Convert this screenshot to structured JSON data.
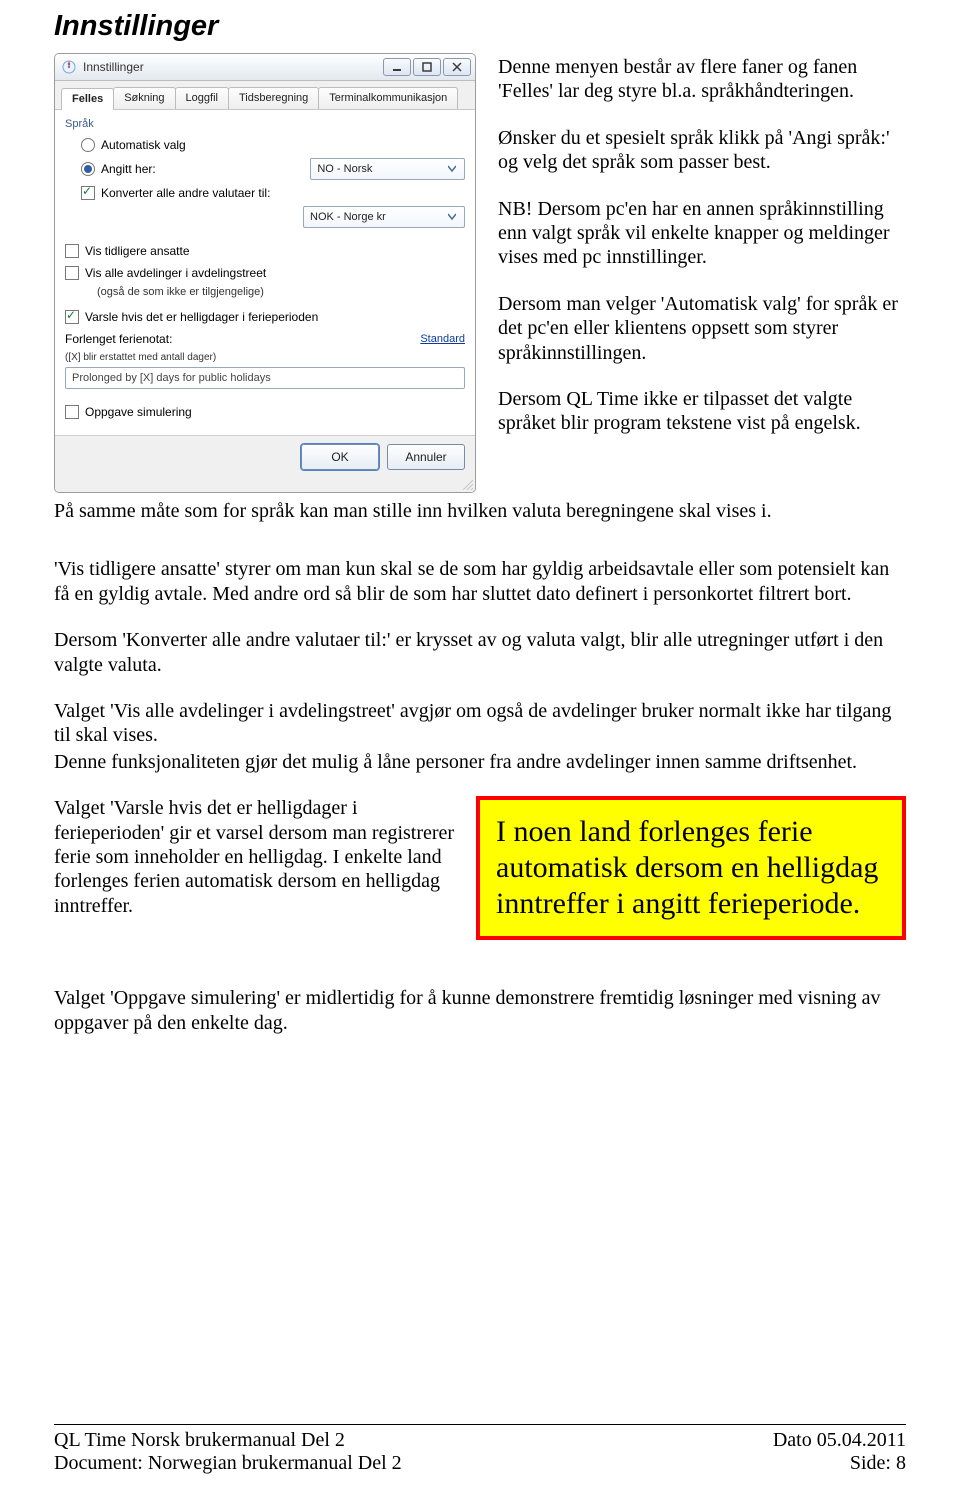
{
  "page_title": "Innstillinger",
  "dialog": {
    "title": "Innstillinger",
    "tabs": [
      "Felles",
      "Søkning",
      "Loggfil",
      "Tidsberegning",
      "Terminalkommunikasjon"
    ],
    "active_tab": 0,
    "group_label": "Språk",
    "automatic_label": "Automatisk valg",
    "specified_label": "Angitt her:",
    "language_value": "NO - Norsk",
    "convert_label": "Konverter alle andre valutaer til:",
    "currency_value": "NOK - Norge kr",
    "show_former_label": "Vis tidligere ansatte",
    "show_all_depts_label": "Vis alle avdelinger i avdelingstreet",
    "show_all_depts_sub": "(også de som ikke er tilgjengelige)",
    "warn_holidays_label": "Varsle hvis det er helligdager i ferieperioden",
    "prolong_label": "Forlenget ferienotat:",
    "prolong_sub": "([X] blir erstattet med antall dager)",
    "standard_link": "Standard",
    "prolong_value": "Prolonged by [X] days for public holidays",
    "task_sim_label": "Oppgave simulering",
    "ok_label": "OK",
    "cancel_label": "Annuler"
  },
  "right_paragraphs": [
    "Denne menyen består av flere faner og fanen 'Felles' lar deg styre bl.a. språkhåndteringen.",
    "Ønsker du et spesielt språk klikk på 'Angi språk:' og velg det språk som passer best.",
    "NB! Dersom pc'en har en annen språkinnstilling enn valgt språk vil enkelte knapper og meldinger vises med pc innstillinger.",
    "Dersom man velger 'Automatisk valg' for språk er det pc'en eller klientens oppsett som styrer språkinnstillingen.",
    "Dersom QL Time ikke er tilpasset det valgte språket blir program tekstene vist på engelsk."
  ],
  "full_width_paragraphs": [
    "På samme måte som for språk kan man stille inn hvilken valuta beregningene skal vises i.",
    "'Vis tidligere ansatte' styrer om man kun skal se de som har gyldig arbeidsavtale eller som potensielt kan få en gyldig avtale. Med andre ord så blir de som har sluttet dato definert i personkortet filtrert bort.",
    "Dersom 'Konverter alle andre valutaer til:' er krysset av og valuta valgt, blir alle utregninger utført i den valgte valuta.",
    "Valget 'Vis alle avdelinger i avdelingstreet' avgjør om også de avdelinger bruker normalt ikke har tilgang til skal vises.",
    "Denne funksjonaliteten gjør det mulig å låne personer fra andre avdelinger innen samme driftsenhet."
  ],
  "split_paragraph": "Valget 'Varsle hvis det er helligdager i ferieperioden' gir et varsel dersom man registrerer ferie som inneholder en helligdag. I enkelte land forlenges ferien automatisk dersom en helligdag inntreffer.",
  "callout_text": "I noen land forlenges ferie automatisk dersom en helligdag inntreffer i angitt ferieperiode.",
  "final_paragraph": "Valget 'Oppgave simulering' er midlertidig for å kunne demonstrere fremtidig løsninger med visning av oppgaver på den enkelte dag.",
  "footer": {
    "left_1": "QL Time Norsk brukermanual Del 2",
    "right_1": "Dato 05.04.2011",
    "left_2": "Document: Norwegian brukermanual Del 2",
    "right_2": "Side: 8"
  }
}
